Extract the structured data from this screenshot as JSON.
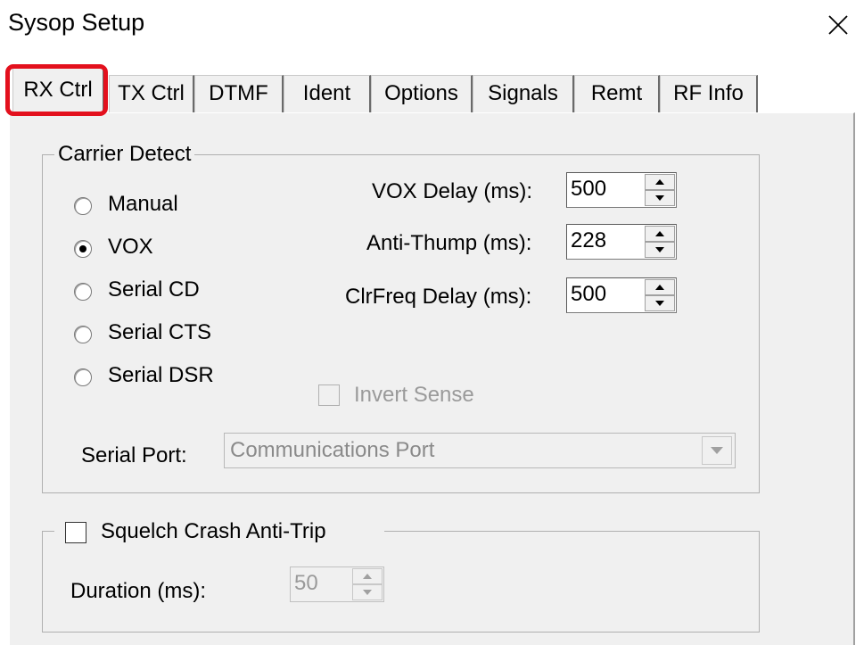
{
  "window": {
    "title": "Sysop Setup",
    "close_icon": "close-x-icon"
  },
  "tabs": [
    {
      "label": "RX Ctrl",
      "active": true
    },
    {
      "label": "TX Ctrl",
      "active": false
    },
    {
      "label": "DTMF",
      "active": false
    },
    {
      "label": "Ident",
      "active": false
    },
    {
      "label": "Options",
      "active": false
    },
    {
      "label": "Signals",
      "active": false
    },
    {
      "label": "Remt",
      "active": false
    },
    {
      "label": "RF Info",
      "active": false
    }
  ],
  "highlight_color": "#e3101d",
  "carrier_detect": {
    "legend": "Carrier Detect",
    "options": [
      {
        "label": "Manual",
        "selected": false
      },
      {
        "label": "VOX",
        "selected": true
      },
      {
        "label": "Serial CD",
        "selected": false
      },
      {
        "label": "Serial CTS",
        "selected": false
      },
      {
        "label": "Serial DSR",
        "selected": false
      }
    ],
    "vox_delay": {
      "label": "VOX Delay (ms):",
      "value": "500"
    },
    "anti_thump": {
      "label": "Anti-Thump (ms):",
      "value": "228"
    },
    "clrfreq_delay": {
      "label": "ClrFreq Delay (ms):",
      "value": "500"
    },
    "invert_sense": {
      "label": "Invert Sense",
      "checked": false,
      "enabled": false
    },
    "serial_port": {
      "label": "Serial Port:",
      "value": "Communications Port",
      "enabled": false
    }
  },
  "squelch": {
    "label": "Squelch Crash Anti-Trip",
    "checked": false,
    "duration": {
      "label": "Duration (ms):",
      "value": "50",
      "enabled": false
    }
  }
}
